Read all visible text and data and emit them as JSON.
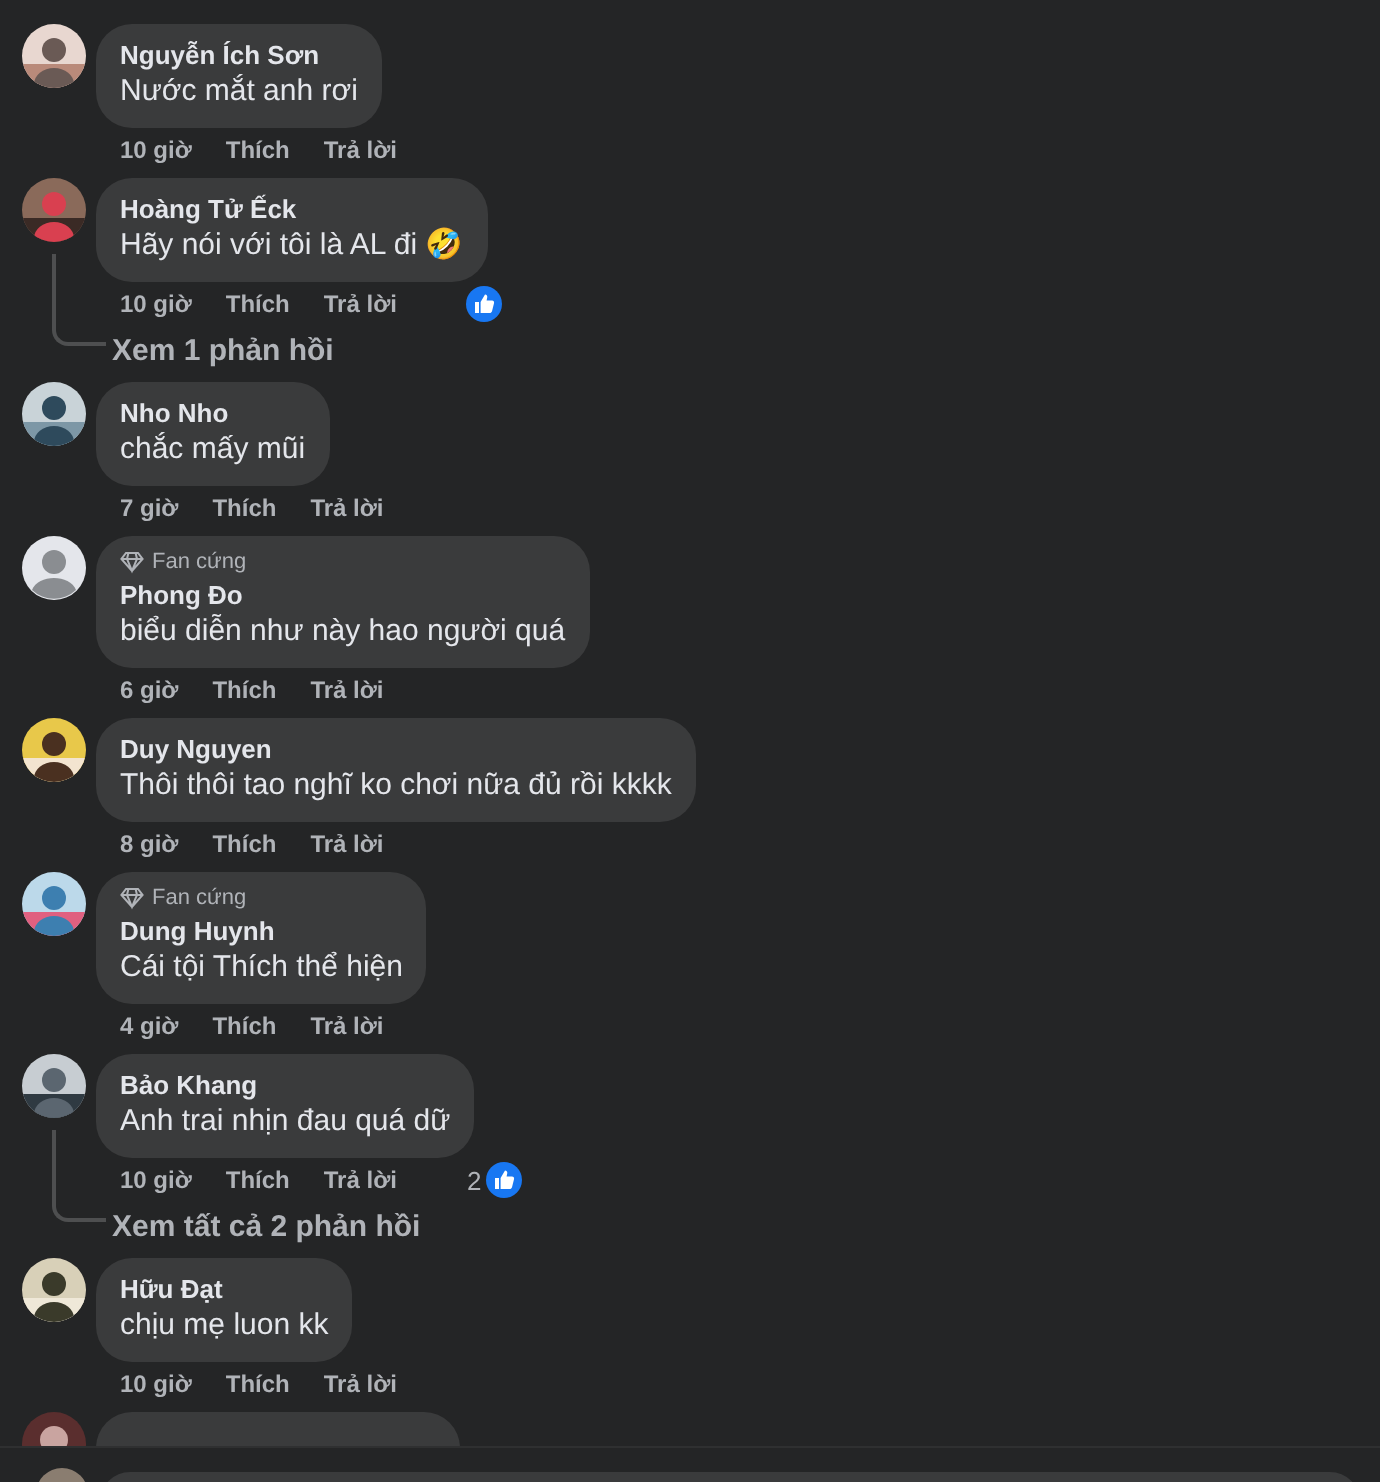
{
  "comments": [
    {
      "name": "Nguyễn Ích Sơn",
      "text": "Nước mắt anh rơi",
      "time": "10 giờ",
      "like": "Thích",
      "reply": "Trả lời"
    },
    {
      "name": "Hoàng Tử Ếck",
      "text": "Hãy nói với tôi là AL đi 🤣",
      "time": "10 giờ",
      "like": "Thích",
      "reply": "Trả lời",
      "reaction": {
        "kind": "like"
      },
      "replies_link": "Xem 1 phản hồi"
    },
    {
      "name": "Nho Nho",
      "text": "chắc mấy mũi",
      "time": "7 giờ",
      "like": "Thích",
      "reply": "Trả lời"
    },
    {
      "avatar": {
        "kind": "silhouette"
      },
      "badge": "Fan cứng",
      "name": "Phong Đo",
      "text": "biểu diễn như này hao người quá",
      "time": "6 giờ",
      "like": "Thích",
      "reply": "Trả lời"
    },
    {
      "name": "Duy Nguyen",
      "text": "Thôi thôi tao nghĩ ko chơi nữa đủ rồi kkkk",
      "time": "8 giờ",
      "like": "Thích",
      "reply": "Trả lời"
    },
    {
      "badge": "Fan cứng",
      "name": "Dung Huynh",
      "text": "Cái tội Thích thể hiện",
      "time": "4 giờ",
      "like": "Thích",
      "reply": "Trả lời"
    },
    {
      "name": "Bảo Khang",
      "text": "Anh trai nhịn đau quá dữ",
      "time": "10 giờ",
      "like": "Thích",
      "reply": "Trả lời",
      "reaction": {
        "kind": "like",
        "count": "2"
      },
      "replies_link": "Xem tất cả 2 phản hồi"
    },
    {
      "name": "Hữu Đạt",
      "text": "chịu mẹ luon kk",
      "time": "10 giờ",
      "like": "Thích",
      "reply": "Trả lời"
    }
  ]
}
